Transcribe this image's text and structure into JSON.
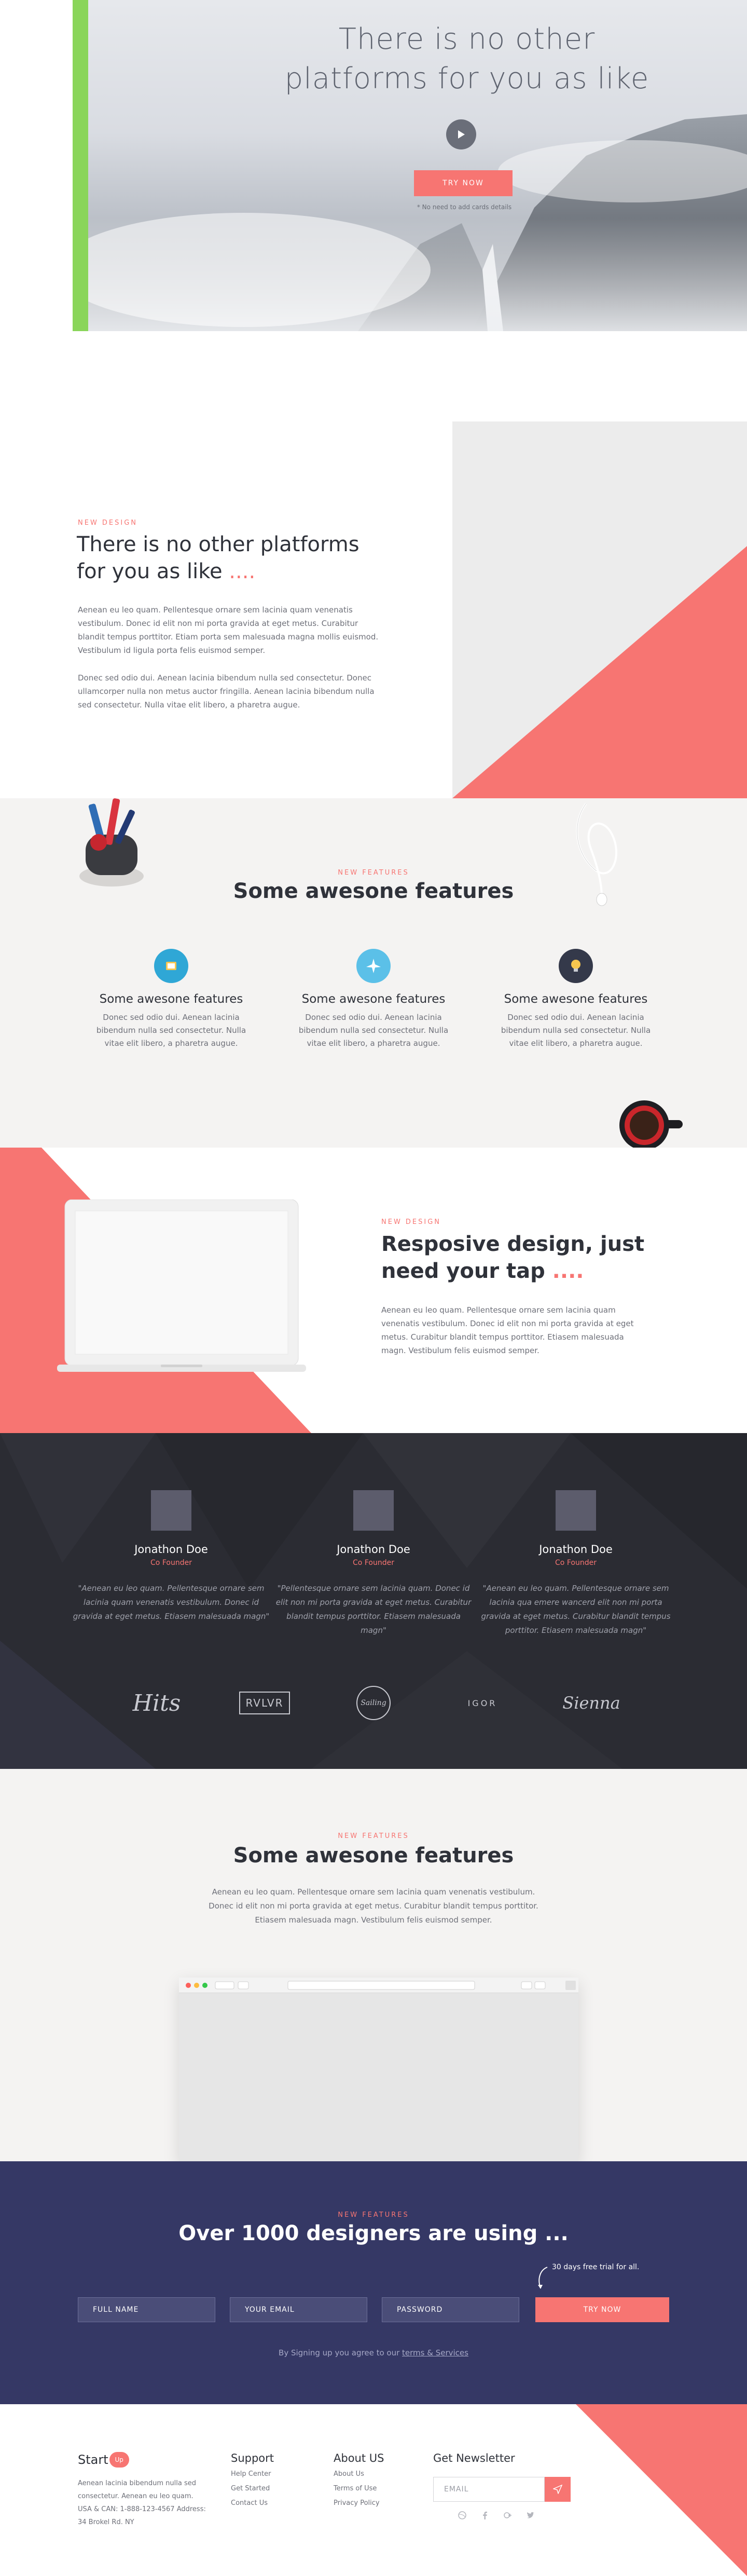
{
  "colors": {
    "accent": "#f77572",
    "green": "#8ad55a",
    "navy": "#353865",
    "dark": "#2b2c33"
  },
  "hero": {
    "title_line1": "There is no other",
    "title_line2": "platforms for you as like",
    "play_icon": "play-icon",
    "cta": "TRY NOW",
    "note": "* No need to add cards details"
  },
  "intro": {
    "tag": "NEW DESIGN",
    "title_line1": "There is no other platforms",
    "title_line2": "for you as like",
    "dots": "....",
    "p1": "Aenean eu leo quam. Pellentesque ornare sem lacinia quam venenatis vestibulum. Donec id elit non mi porta gravida at eget metus. Curabitur blandit tempus porttitor. Etiam porta sem malesuada magna mollis euismod. Vestibulum id ligula porta felis euismod semper.",
    "p2": "Donec sed odio dui. Aenean lacinia bibendum nulla sed consectetur. Donec ullamcorper nulla non metus auctor fringilla. Aenean lacinia bibendum nulla sed consectetur. Nulla vitae elit libero, a pharetra augue."
  },
  "features": {
    "tag": "NEW FEATURES",
    "title": "Some awesone features",
    "items": [
      {
        "icon": "layers-icon",
        "name": "Some awesone features",
        "desc": "Donec sed odio dui. Aenean lacinia bibendum nulla sed consectetur. Nulla vitae elit libero, a pharetra augue."
      },
      {
        "icon": "airplane-icon",
        "name": "Some awesone features",
        "desc": "Donec sed odio dui. Aenean lacinia bibendum nulla sed consectetur. Nulla vitae elit libero, a pharetra augue."
      },
      {
        "icon": "lightbulb-icon",
        "name": "Some awesone features",
        "desc": "Donec sed odio dui. Aenean lacinia bibendum nulla sed consectetur. Nulla vitae elit libero, a pharetra augue."
      }
    ]
  },
  "responsive": {
    "tag": "NEW DESIGN",
    "title_line1": "Resposive design, just",
    "title_line2": "need your tap",
    "dots": "....",
    "desc": "Aenean eu leo quam. Pellentesque ornare sem lacinia quam venenatis vestibulum. Donec id elit non mi porta gravida at eget metus. Curabitur blandit tempus porttitor. Etiasem malesuada magn. Vestibulum felis euismod semper."
  },
  "team": {
    "members": [
      {
        "name": "Jonathon Doe",
        "role": "Co Founder",
        "quote": "\"Aenean eu leo quam. Pellentesque ornare sem lacinia quam venenatis vestibulum. Donec id gravida at eget metus. Etiasem malesuada magn\""
      },
      {
        "name": "Jonathon Doe",
        "role": "Co Founder",
        "quote": "\"Pellentesque ornare sem lacinia quam. Donec id elit non mi porta gravida at eget metus. Curabitur blandit tempus porttitor. Etiasem malesuada magn\""
      },
      {
        "name": "Jonathon Doe",
        "role": "Co Founder",
        "quote": "\"Aenean eu leo quam. Pellentesque ornare sem lacinia qua emere  wancerd elit non mi porta gravida at eget metus. Curabitur blandit tempus porttitor. Etiasem malesuada magn\""
      }
    ],
    "logos": [
      {
        "icon": "hits-logo",
        "text": "Hits"
      },
      {
        "icon": "rvlvr-logo",
        "text": "RVLVR"
      },
      {
        "icon": "sailing-logo",
        "text": "Sailing"
      },
      {
        "icon": "igor-logo",
        "text": "IGOR"
      },
      {
        "icon": "sienna-logo",
        "text": "Sienna"
      }
    ]
  },
  "showcase": {
    "tag": "NEW FEATURES",
    "title": "Some awesone features",
    "desc": "Aenean eu leo quam. Pellentesque ornare sem lacinia quam venenatis vestibulum. Donec id elit non mi porta gravida at eget metus. Curabitur blandit tempus porttitor. Etiasem malesuada magn. Vestibulum felis euismod semper."
  },
  "signup": {
    "tag": "NEW FEATURES",
    "title": "Over 1000 designers are using ...",
    "trial_note": "30 days free trial for all.",
    "fullname_placeholder": "FULL NAME",
    "email_placeholder": "YOUR EMAIL",
    "password_placeholder": "PASSWORD",
    "cta": "TRY NOW",
    "terms_prefix": "By Signing up you agree to our ",
    "terms_link": "terms & Services"
  },
  "footer": {
    "brand": "Start",
    "brand_mark": "Up",
    "desc": "Aenean lacinia bibendum nulla sed consectetur. Aenean eu leo quam. USA & CAN: 1-888-123-4567 Address: 34 Brokel Rd. NY",
    "support": {
      "title": "Support",
      "links": [
        "Help Center",
        "Get Started",
        "Contact Us"
      ]
    },
    "about": {
      "title": "About US",
      "links": [
        "About Us",
        "Terms of Use",
        "Privacy Policy"
      ]
    },
    "newsletter": {
      "title": "Get Newsletter",
      "placeholder": "EMAIL"
    },
    "socials": [
      "dribbble-icon",
      "facebook-icon",
      "google-plus-icon",
      "twitter-icon"
    ]
  }
}
